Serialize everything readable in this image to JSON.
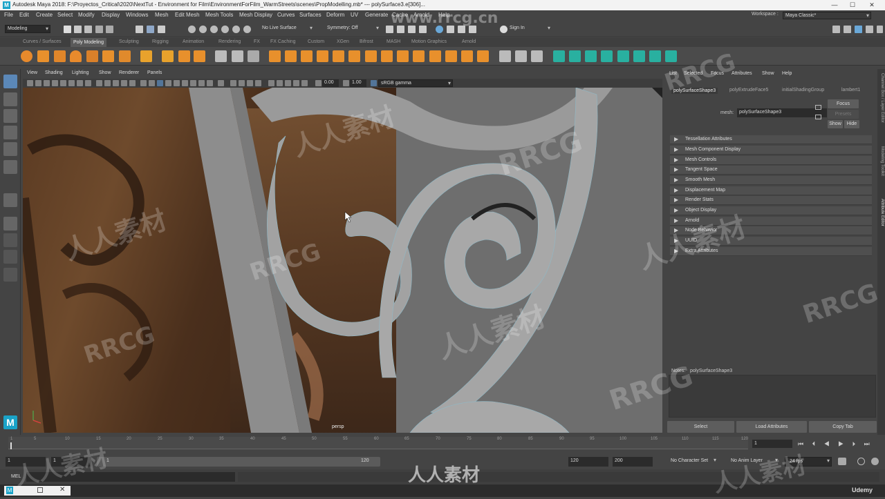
{
  "window": {
    "title": "Autodesk Maya 2018: F:\\Proyectos_Critical\\2020\\NextTut - Environment for Film\\EnvironmentForFilm_WarmStreets\\scenes\\PropModelling.mb*   ---   polySurface3.e[306]...",
    "app_icon": "M",
    "minimize": "—",
    "maximize": "☐",
    "close": "✕"
  },
  "menubar": {
    "items": [
      "File",
      "Edit",
      "Create",
      "Select",
      "Modify",
      "Display",
      "Windows",
      "Mesh",
      "Edit Mesh",
      "Mesh Tools",
      "Mesh Display",
      "Curves",
      "Surfaces",
      "Deform",
      "UV",
      "Generate",
      "Cache",
      "Arnold",
      "Help"
    ],
    "workspace_label": "Workspace :",
    "workspace_value": "Maya Classic*"
  },
  "statusline": {
    "mode": "Modeling",
    "live_surface": "No Live Surface",
    "symmetry": "Symmetry: Off",
    "sign_in": "Sign In"
  },
  "shelf": {
    "tabs": [
      "Curves / Surfaces",
      "Poly Modeling",
      "Sculpting",
      "Rigging",
      "Animation",
      "Rendering",
      "FX",
      "FX Caching",
      "Custom",
      "XGen",
      "Bifrost",
      "MASH",
      "Motion Graphics",
      "Arnold"
    ],
    "active_tab": "Poly Modeling"
  },
  "viewport": {
    "menus": [
      "View",
      "Shading",
      "Lighting",
      "Show",
      "Renderer",
      "Panels"
    ],
    "field_a": "0.00",
    "field_b": "1.00",
    "color_space": "sRGB gamma",
    "camera_label": "persp"
  },
  "channel_box": {
    "menus": [
      "List",
      "Selected",
      "Focus",
      "Attributes",
      "Show",
      "Help"
    ],
    "tabs": [
      "polySurfaceShape3",
      "polyExtrudeFace5",
      "initialShadingGroup",
      "lambert1"
    ],
    "mesh_label": "mesh:",
    "mesh_value": "polySurfaceShape3",
    "focus_button": "Focus",
    "presets_button": "Presets",
    "show_button": "Show",
    "hide_button": "Hide",
    "sections": [
      "Tessellation Attributes",
      "Mesh Component Display",
      "Mesh Controls",
      "Tangent Space",
      "Smooth Mesh",
      "Displacement Map",
      "Render Stats",
      "Object Display",
      "Arnold",
      "Node Behavior",
      "UUID",
      "Extra Attributes"
    ],
    "notes_label": "Notes:",
    "notes_value": "polySurfaceShape3",
    "select_button": "Select",
    "load_button": "Load Attributes",
    "copy_button": "Copy Tab"
  },
  "side_tabs": [
    "Channel Box / Layer Editor",
    "Modeling Toolkit",
    "Attribute Editor"
  ],
  "timeslider": {
    "ticks": [
      "1",
      "5",
      "10",
      "15",
      "20",
      "25",
      "30",
      "35",
      "40",
      "45",
      "50",
      "55",
      "60",
      "65",
      "70",
      "75",
      "80",
      "85",
      "90",
      "95",
      "100",
      "105",
      "110",
      "115",
      "120"
    ],
    "current_frame": "1"
  },
  "rangeslider": {
    "start": "1",
    "anim_start": "1",
    "range_start": "1",
    "range_end": "120",
    "anim_end": "120",
    "end": "200",
    "character_set": "No Character Set",
    "anim_layer": "No Anim Layer",
    "fps": "24 fps"
  },
  "cmdline": {
    "label": "MEL"
  },
  "watermarks": [
    "RRCG",
    "人人素材",
    "www.rrcg.cn",
    "Udemy"
  ]
}
